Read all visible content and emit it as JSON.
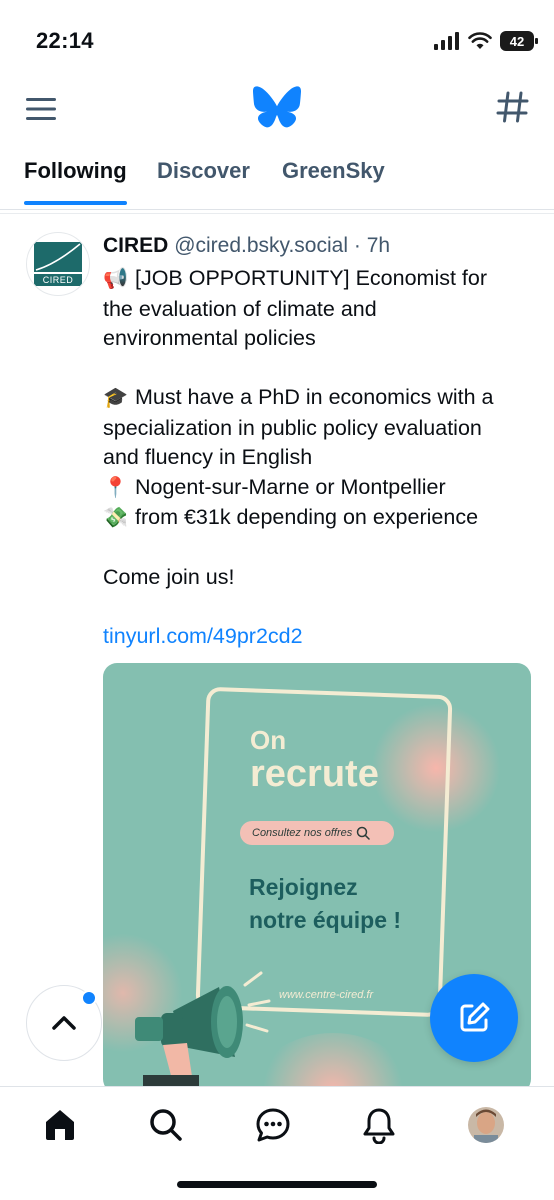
{
  "status_bar": {
    "time": "22:14",
    "battery": "42",
    "icons": [
      "signal-icon",
      "wifi-icon",
      "battery-icon"
    ]
  },
  "header": {
    "menu_icon": "menu-icon",
    "logo_icon": "butterfly-logo-icon",
    "feeds_icon": "hash-icon"
  },
  "tabs": [
    {
      "label": "Following",
      "active": true
    },
    {
      "label": "Discover",
      "active": false
    },
    {
      "label": "GreenSky",
      "active": false
    }
  ],
  "post": {
    "author": "CIRED",
    "handle": "@cired.bsky.social",
    "separator": "·",
    "time": "7h",
    "lines": [
      {
        "emoji": "📢",
        "text": "[JOB OPPORTUNITY] Economist for"
      },
      {
        "text": "the evaluation of climate and"
      },
      {
        "text": "environmental policies"
      },
      {
        "gap": true
      },
      {
        "emoji": "🎓",
        "text": "Must have a PhD in economics with a"
      },
      {
        "text": "specialization in public policy evaluation"
      },
      {
        "text": "and fluency in English"
      },
      {
        "emoji": "📍",
        "text": "Nogent-sur-Marne or Montpellier"
      },
      {
        "emoji": "💸",
        "text": "from €31k depending on experience"
      },
      {
        "gap": true
      },
      {
        "text": "Come join us!"
      },
      {
        "gap": true
      }
    ],
    "link": "tinyurl.com/49pr2cd2",
    "avatar_text": "CIRED",
    "image": {
      "on": "On",
      "recrute": "recrute",
      "pill": "Consultez nos offres",
      "rejoignez_1": "Rejoignez",
      "rejoignez_2": "notre équipe !",
      "site": "www.centre-cired.fr"
    }
  },
  "floating": {
    "scroll_top_icon": "chevron-up-icon",
    "compose_icon": "compose-icon"
  },
  "bottom_nav": [
    "home-icon",
    "search-icon",
    "chat-icon",
    "bell-icon",
    "profile-avatar"
  ],
  "colors": {
    "accent": "#1083fe",
    "text": "#0b0f14",
    "muted": "#42576c",
    "poster_bg": "#84bfb0",
    "poster_cream": "#f4ecd3",
    "poster_teal": "#1d5e5e"
  }
}
